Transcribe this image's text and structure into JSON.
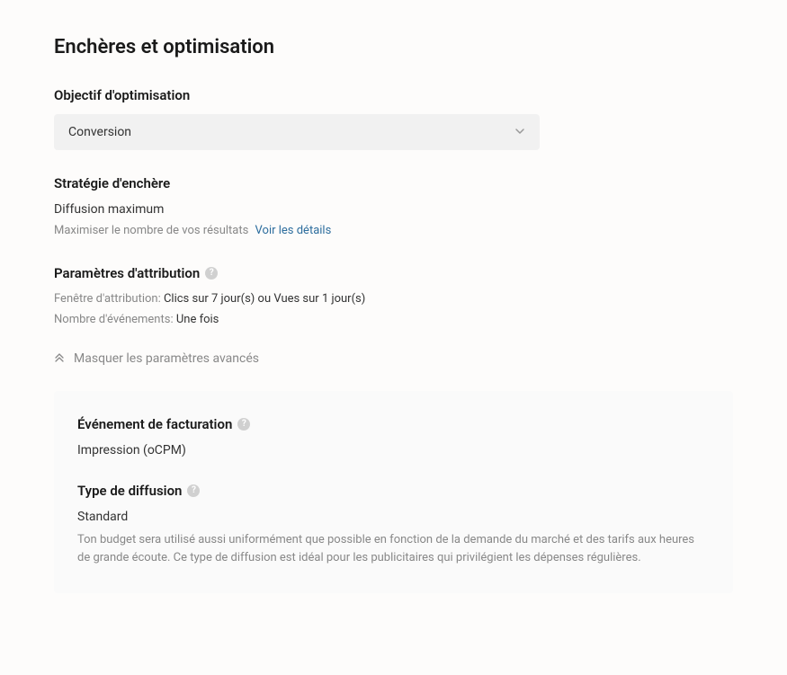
{
  "title": "Enchères et optimisation",
  "optimization": {
    "label": "Objectif d'optimisation",
    "value": "Conversion"
  },
  "bidStrategy": {
    "label": "Stratégie d'enchère",
    "value": "Diffusion maximum",
    "description": "Maximiser le nombre de vos résultats",
    "linkText": "Voir les détails"
  },
  "attribution": {
    "label": "Paramètres d'attribution",
    "windowLabel": "Fenêtre d'attribution:",
    "windowValue": "Clics sur 7 jour(s) ou Vues sur 1 jour(s)",
    "eventsLabel": "Nombre d'événements:",
    "eventsValue": "Une fois"
  },
  "advancedToggle": "Masquer les paramètres avancés",
  "billing": {
    "label": "Événement de facturation",
    "value": "Impression (oCPM)"
  },
  "delivery": {
    "label": "Type de diffusion",
    "value": "Standard",
    "description": "Ton budget sera utilisé aussi uniformément que possible en fonction de la demande du marché et des tarifs aux heures de grande écoute. Ce type de diffusion est idéal pour les publicitaires qui privilégient les dépenses régulières."
  }
}
